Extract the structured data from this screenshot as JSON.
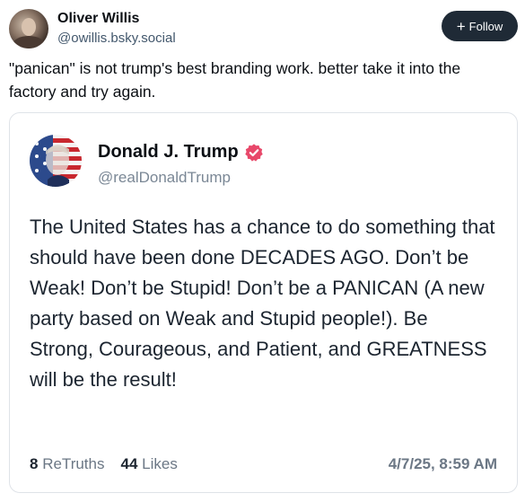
{
  "post": {
    "author_name": "Oliver Willis",
    "author_handle": "@owillis.bsky.social",
    "follow_label": "Follow",
    "text": "\"panican\" is not trump's best branding work. better take it into the factory and try again."
  },
  "embed": {
    "author_name": "Donald J. Trump",
    "author_handle": "@realDonaldTrump",
    "text": "The United States has a chance to do something that should have been done DECADES AGO. Don’t be Weak! Don’t be Stupid! Don’t be a PANICAN (A new party based on Weak and Stupid people!). Be Strong, Courageous, and Patient, and GREATNESS will be the result!",
    "retruths_count": "8",
    "retruths_label": "ReTruths",
    "likes_count": "44",
    "likes_label": "Likes",
    "timestamp": "4/7/25, 8:59 AM"
  },
  "colors": {
    "follow_bg": "#1f2a36",
    "verified_badge": "#e8486a",
    "handle_text": "#42576c",
    "card_border": "#dfe3e8"
  },
  "icons": {
    "follow": "plus-icon",
    "verified": "verified-badge-icon"
  }
}
